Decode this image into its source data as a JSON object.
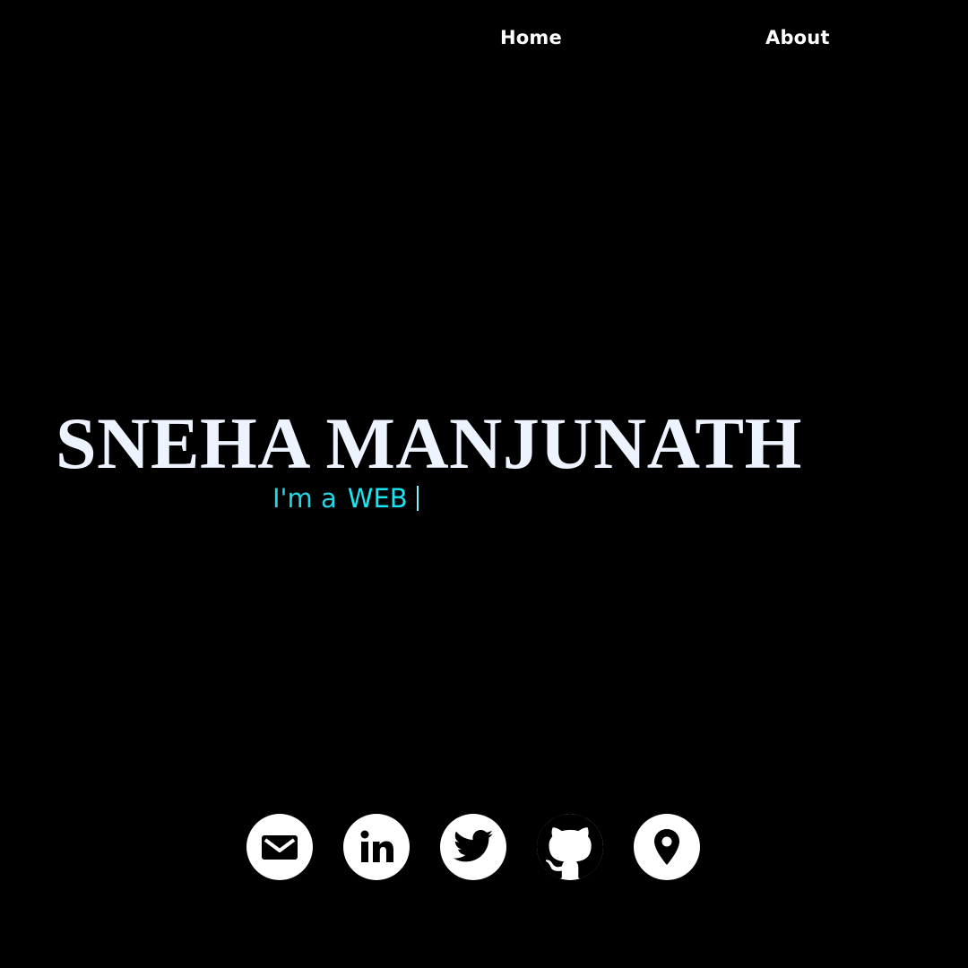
{
  "nav": {
    "home_label": "Home",
    "about_label": "About"
  },
  "hero": {
    "name": "SNEHA MANJUNATH",
    "tagline_prefix": "I'm a",
    "tagline_typed": "WEB"
  },
  "social": [
    {
      "icon": "envelope-icon",
      "label": "email"
    },
    {
      "icon": "linkedin-icon",
      "label": "linkedin"
    },
    {
      "icon": "twitter-icon",
      "label": "twitter"
    },
    {
      "icon": "github-icon",
      "label": "github"
    },
    {
      "icon": "map-pin-icon",
      "label": "location"
    }
  ],
  "colors": {
    "background": "#000000",
    "text": "#ffffff",
    "name": "#eef4ff",
    "accent": "#17e6f2",
    "icon_fill": "#000000",
    "icon_bg": "#ffffff"
  }
}
